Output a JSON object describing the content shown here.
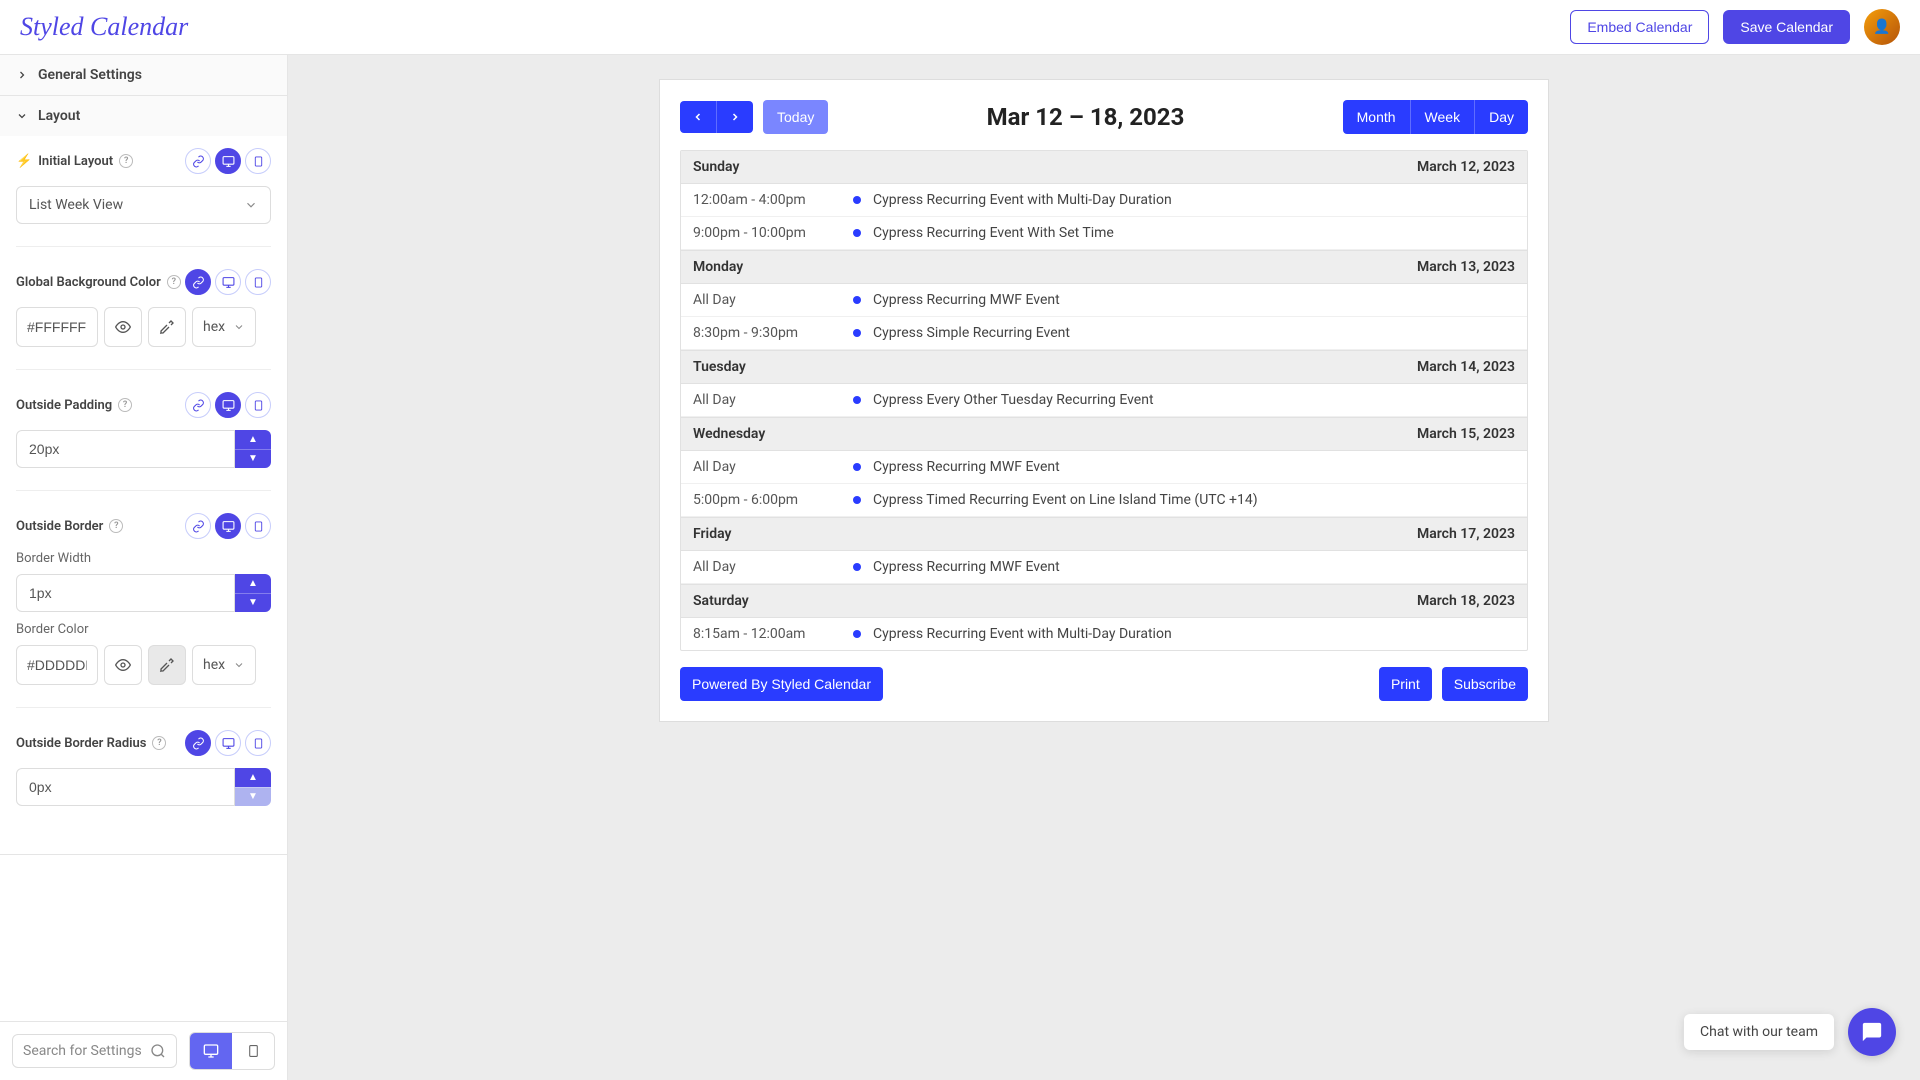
{
  "brand": "Styled Calendar",
  "header": {
    "embed": "Embed Calendar",
    "save": "Save Calendar"
  },
  "sidebar": {
    "sections": {
      "general": "General Settings",
      "layout": "Layout"
    },
    "initialLayout": {
      "label": "Initial Layout",
      "value": "List Week View"
    },
    "bgColor": {
      "label": "Global Background Color",
      "value": "#FFFFFF",
      "format": "hex"
    },
    "outsidePadding": {
      "label": "Outside Padding",
      "value": "20px"
    },
    "outsideBorder": {
      "label": "Outside Border",
      "widthLabel": "Border Width",
      "widthValue": "1px",
      "colorLabel": "Border Color",
      "colorValue": "#DDDDDD",
      "format": "hex"
    },
    "borderRadius": {
      "label": "Outside Border Radius",
      "value": "0px"
    },
    "search": "Search for Settings"
  },
  "calendar": {
    "title": "Mar 12 – 18, 2023",
    "today": "Today",
    "views": {
      "month": "Month",
      "week": "Week",
      "day": "Day"
    },
    "days": [
      {
        "name": "Sunday",
        "date": "March 12, 2023",
        "events": [
          {
            "time": "12:00am - 4:00pm",
            "title": "Cypress Recurring Event with Multi-Day Duration"
          },
          {
            "time": "9:00pm - 10:00pm",
            "title": "Cypress Recurring Event With Set Time"
          }
        ]
      },
      {
        "name": "Monday",
        "date": "March 13, 2023",
        "events": [
          {
            "time": "All Day",
            "title": "Cypress Recurring MWF Event"
          },
          {
            "time": "8:30pm - 9:30pm",
            "title": "Cypress Simple Recurring Event"
          }
        ]
      },
      {
        "name": "Tuesday",
        "date": "March 14, 2023",
        "events": [
          {
            "time": "All Day",
            "title": "Cypress Every Other Tuesday Recurring Event"
          }
        ]
      },
      {
        "name": "Wednesday",
        "date": "March 15, 2023",
        "events": [
          {
            "time": "All Day",
            "title": "Cypress Recurring MWF Event"
          },
          {
            "time": "5:00pm - 6:00pm",
            "title": "Cypress Timed Recurring Event on Line Island Time (UTC +14)"
          }
        ]
      },
      {
        "name": "Friday",
        "date": "March 17, 2023",
        "events": [
          {
            "time": "All Day",
            "title": "Cypress Recurring MWF Event"
          }
        ]
      },
      {
        "name": "Saturday",
        "date": "March 18, 2023",
        "events": [
          {
            "time": "8:15am - 12:00am",
            "title": "Cypress Recurring Event with Multi-Day Duration"
          }
        ]
      }
    ],
    "footer": {
      "powered": "Powered By Styled Calendar",
      "print": "Print",
      "subscribe": "Subscribe"
    }
  },
  "chat": "Chat with our team"
}
